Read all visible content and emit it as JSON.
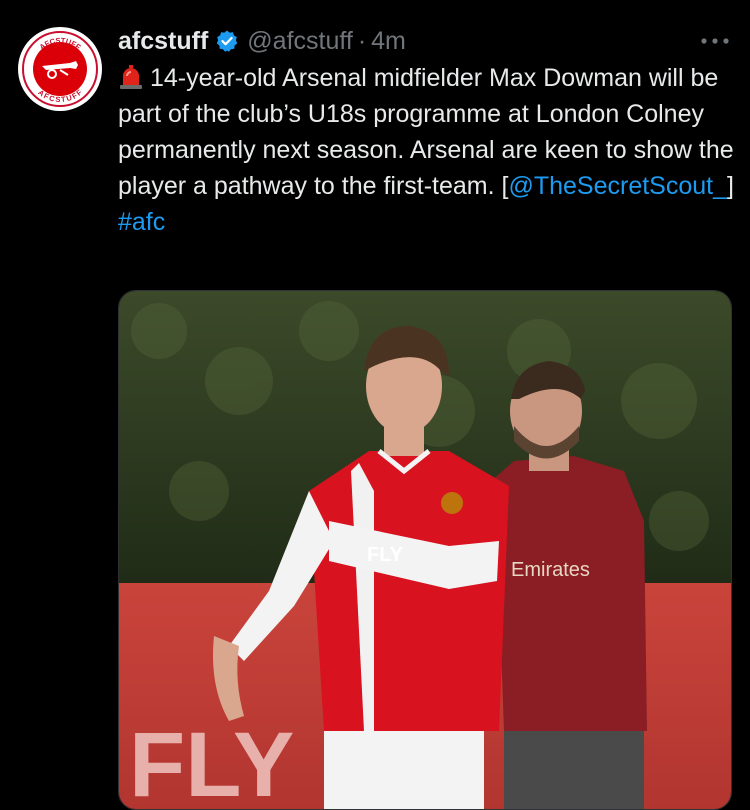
{
  "tweet": {
    "display_name": "afcstuff",
    "handle": "@afcstuff",
    "separator": "·",
    "time": "4m",
    "emoji_icon": "siren-icon",
    "text_before": "14-year-old Arsenal midfielder Max Dowman will be part of the club’s U18s programme at London Colney permanently next season. Arsenal are keen to show the player a pathway to the first-team. [",
    "mention": "@TheSecretScout_",
    "text_after": "]",
    "hashtag": "#afc",
    "avatar_text_top": "AFCSTUFF",
    "avatar_text_bottom": "AFCSTUFF",
    "verified_icon": "verified-badge-icon",
    "more_icon": "more-options-icon"
  },
  "media": {
    "kit_sponsor_text": "Emirates",
    "shirt_text": "FLY",
    "board_text": "FLY"
  },
  "colors": {
    "background": "#000000",
    "text": "#e7e9ea",
    "muted": "#71767b",
    "link": "#1d9bf0",
    "arsenal_red": "#db0007"
  }
}
